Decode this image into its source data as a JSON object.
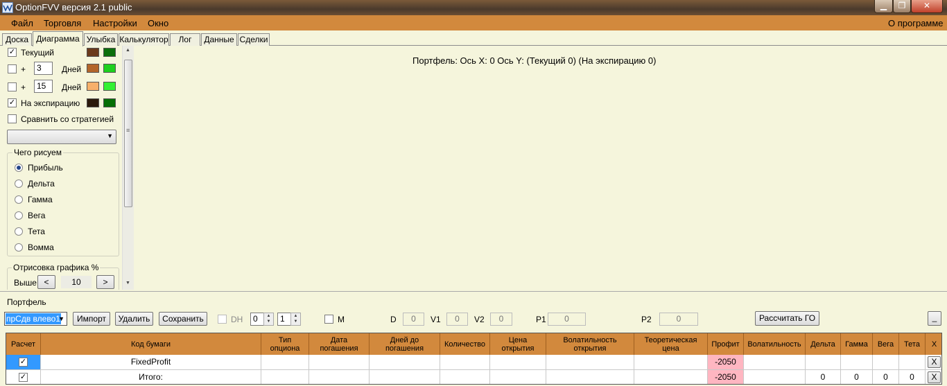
{
  "window": {
    "title": "OptionFVV версия 2.1 public"
  },
  "menu": {
    "file": "Файл",
    "trading": "Торговля",
    "settings": "Настройки",
    "window": "Окно",
    "about": "О программе"
  },
  "tabs": [
    "Доска",
    "Диаграмма",
    "Улыбка",
    "Калькулятор",
    "Лог",
    "Данные",
    "Сделки"
  ],
  "left": {
    "current": "Текущий",
    "plus": "+",
    "days1": "3",
    "days2": "15",
    "days_label": "Дней",
    "expiration": "На экспирацию",
    "compare": "Сравнить со стратегией",
    "draw_group": "Чего рисуем",
    "radios": [
      "Прибыль",
      "Дельта",
      "Гамма",
      "Вега",
      "Тета",
      "Вомма"
    ],
    "chart_group": "Отрисовка графика %",
    "above": "Выше",
    "above_value": "10",
    "dec": "<",
    "inc": ">"
  },
  "colors": {
    "current_main": "#6b3a1c",
    "current_alt": "#0b6e0b",
    "days1_main": "#b3652a",
    "days1_alt": "#1ed01e",
    "days2_main": "#f7b06a",
    "days2_alt": "#33f033",
    "exp_main": "#2c1a0c",
    "exp_alt": "#056e05"
  },
  "chart": {
    "caption": "Портфель: Ось X: 0 Ось Y:  (Текущий 0)  (На экспирацию 0)"
  },
  "portfolio": {
    "title": "Портфель",
    "selector": "прСдв влево1",
    "import": "Импорт",
    "delete": "Удалить",
    "save": "Сохранить",
    "dh": "DH",
    "spin1": "0",
    "spin2": "1",
    "m": "M",
    "d_label": "D",
    "d_val": "0",
    "v1_label": "V1",
    "v1_val": "0",
    "v2_label": "V2",
    "v2_val": "0",
    "p1_label": "P1",
    "p1_val": "0",
    "p2_label": "P2",
    "p2_val": "0",
    "calc_go": "Рассчитать ГО",
    "collapse": "_"
  },
  "table": {
    "headers": [
      "Расчет",
      "Код бумаги",
      "Тип опциона",
      "Дата погашения",
      "Дней до погашения",
      "Количество",
      "Цена открытия",
      "Волатильность открытия",
      "Теоретическая цена",
      "Профит",
      "Волатильность",
      "Дельта",
      "Гамма",
      "Вега",
      "Тета",
      "X"
    ],
    "rows": [
      {
        "code": "FixedProfit",
        "profit": "-2050",
        "delta": "",
        "gamma": "",
        "vega": "",
        "theta": "",
        "x": "X"
      },
      {
        "code": "Итого:",
        "profit": "-2050",
        "delta": "0",
        "gamma": "0",
        "vega": "0",
        "theta": "0",
        "x": "X"
      }
    ]
  }
}
